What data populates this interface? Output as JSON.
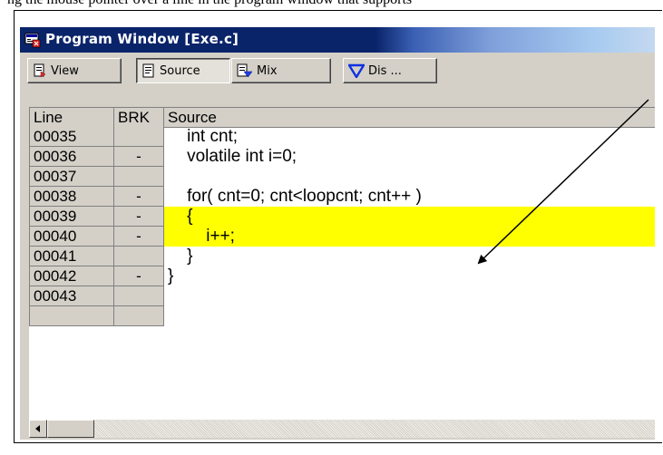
{
  "document": {
    "top_text": "ng the mouse pointer over a line in the program window that supports"
  },
  "window": {
    "title": "Program Window [Exe.c]",
    "toolbar": {
      "view_label": "View",
      "source_label": "Source",
      "mix_label": "Mix",
      "dis_label": "Dis ..."
    }
  },
  "columns": {
    "line": "Line",
    "brk": "BRK",
    "source": "Source"
  },
  "rows": [
    {
      "line": "00035",
      "brk": "",
      "source": "    int cnt;",
      "highlighted": false
    },
    {
      "line": "00036",
      "brk": "-",
      "source": "    volatile int i=0;",
      "highlighted": false
    },
    {
      "line": "00037",
      "brk": "",
      "source": "",
      "highlighted": false
    },
    {
      "line": "00038",
      "brk": "-",
      "source": "    for( cnt=0; cnt<loopcnt; cnt++ )",
      "highlighted": false
    },
    {
      "line": "00039",
      "brk": "-",
      "source": "    {",
      "highlighted": true
    },
    {
      "line": "00040",
      "brk": "-",
      "source": "        i++;",
      "highlighted": true
    },
    {
      "line": "00041",
      "brk": "",
      "source": "    }",
      "highlighted": false
    },
    {
      "line": "00042",
      "brk": "-",
      "source": "}",
      "highlighted": false
    },
    {
      "line": "00043",
      "brk": "",
      "source": "",
      "highlighted": false
    },
    {
      "line": "",
      "brk": "",
      "source": "",
      "highlighted": false
    }
  ],
  "colors": {
    "highlight": "#ffff00",
    "titlebar": "#0a246a",
    "face": "#d4d0c8"
  },
  "icons": [
    "program-window-icon",
    "view-icon",
    "source-icon",
    "mix-icon",
    "dis-icon",
    "scroll-left-icon"
  ]
}
